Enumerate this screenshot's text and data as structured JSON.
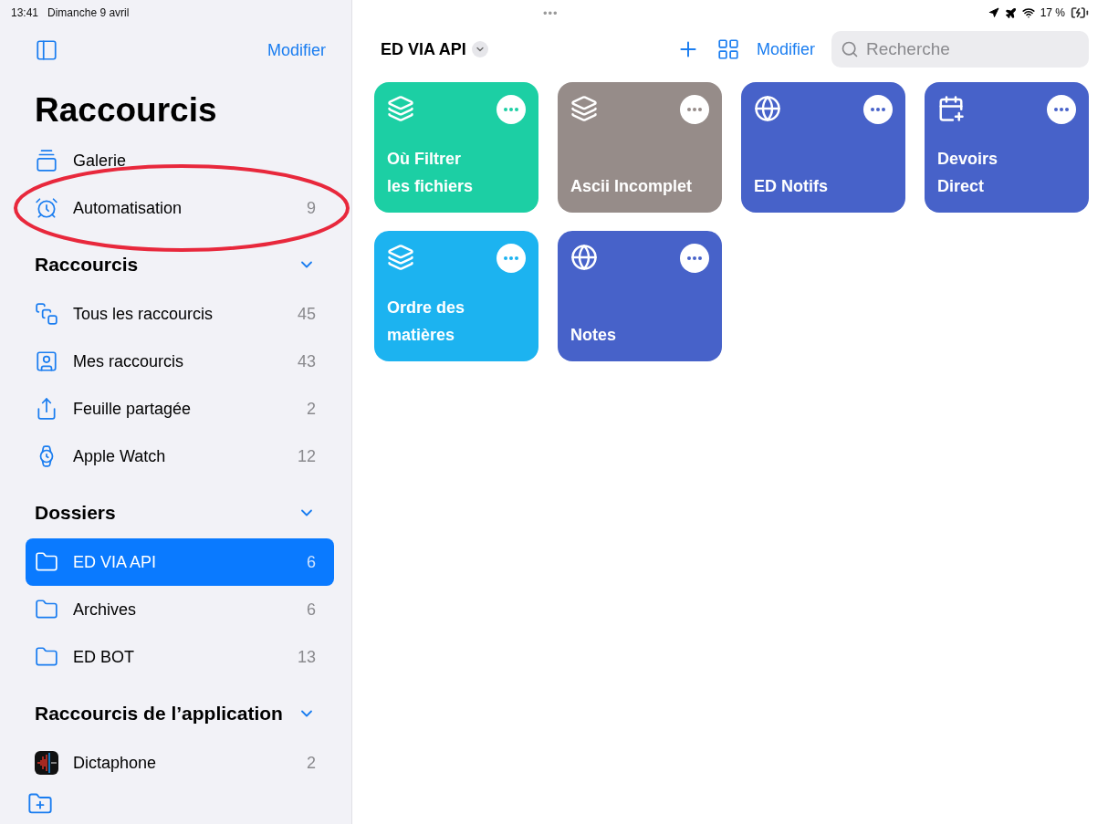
{
  "status_bar": {
    "time": "13:41",
    "date": "Dimanche 9 avril",
    "multitask": "•••",
    "battery": "17 %"
  },
  "sidebar": {
    "edit": "Modifier",
    "title": "Raccourcis",
    "top_items": [
      {
        "label": "Galerie",
        "kind": "gallery",
        "circled": false
      },
      {
        "label": "Automatisation",
        "count": "9",
        "kind": "automation",
        "circled": true
      }
    ],
    "sections": [
      {
        "title": "Raccourcis",
        "expanded": true,
        "items": [
          {
            "label": "Tous les raccourcis",
            "count": "45",
            "kind": "all",
            "selected": false
          },
          {
            "label": "Mes raccourcis",
            "count": "43",
            "kind": "mine",
            "selected": false
          },
          {
            "label": "Feuille partagée",
            "count": "2",
            "kind": "share",
            "selected": false
          },
          {
            "label": "Apple Watch",
            "count": "12",
            "kind": "watch",
            "selected": false
          }
        ]
      },
      {
        "title": "Dossiers",
        "expanded": true,
        "items": [
          {
            "label": "ED VIA API",
            "count": "6",
            "kind": "folder",
            "selected": true
          },
          {
            "label": "Archives",
            "count": "6",
            "kind": "folder",
            "selected": false
          },
          {
            "label": "ED BOT",
            "count": "13",
            "kind": "folder",
            "selected": false
          }
        ]
      },
      {
        "title": "Raccourcis de l’application",
        "expanded": true,
        "items": [
          {
            "label": "Dictaphone",
            "count": "2",
            "kind": "app",
            "selected": false
          }
        ]
      }
    ]
  },
  "main": {
    "folder": "ED VIA API",
    "edit": "Modifier",
    "search": {
      "placeholder": "Recherche"
    },
    "shortcuts": [
      {
        "title": "Où Filtrer\nles fichiers",
        "kind": "script",
        "color": "#1ccfa4"
      },
      {
        "title": "Ascii Incomplet",
        "kind": "script",
        "color": "#968c89"
      },
      {
        "title": "ED Notifs",
        "kind": "web",
        "color": "#4762c9"
      },
      {
        "title": "Devoirs\nDirect",
        "kind": "calendar",
        "color": "#4762c9"
      },
      {
        "title": "Ordre des\nmatières",
        "kind": "script",
        "color": "#1cb3f0"
      },
      {
        "title": "Notes",
        "kind": "web",
        "color": "#4762c9"
      }
    ]
  }
}
